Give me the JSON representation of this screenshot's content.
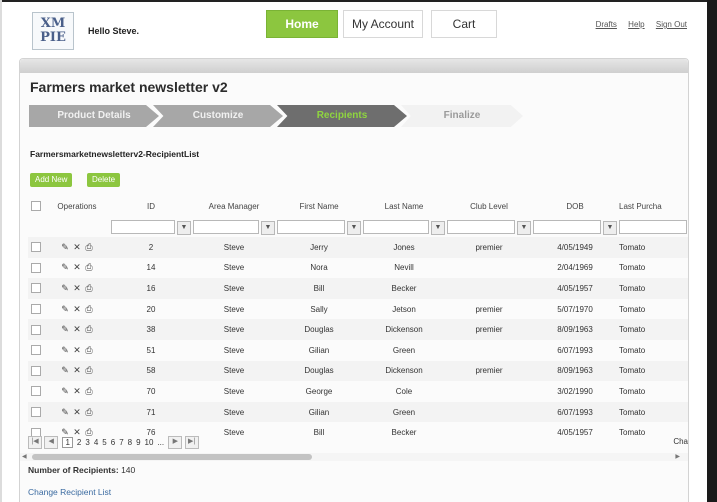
{
  "header": {
    "logo_line1": "XM",
    "logo_line2": "PIE",
    "greeting": "Hello Steve.",
    "nav": {
      "home": "Home",
      "account": "My Account",
      "cart": "Cart"
    },
    "links": {
      "drafts": "Drafts",
      "help": "Help",
      "signout": "Sign Out"
    }
  },
  "page": {
    "title": "Farmers market newsletter v2",
    "steps": [
      "Product Details",
      "Customize",
      "Recipients",
      "Finalize"
    ],
    "active_step": "Recipients",
    "list_title": "Farmersmarketnewsletterv2-RecipientList",
    "buttons": {
      "add": "Add New",
      "delete": "Delete"
    }
  },
  "table": {
    "columns": [
      "Operations",
      "ID",
      "Area Manager",
      "First Name",
      "Last Name",
      "Club Level",
      "DOB",
      "Last Purcha"
    ],
    "rows": [
      [
        "2",
        "Steve",
        "Jerry",
        "Jones",
        "premier",
        "4/05/1949",
        "Tomato"
      ],
      [
        "14",
        "Steve",
        "Nora",
        "Nevill",
        "",
        "2/04/1969",
        "Tomato"
      ],
      [
        "16",
        "Steve",
        "Bill",
        "Becker",
        "",
        "4/05/1957",
        "Tomato"
      ],
      [
        "20",
        "Steve",
        "Sally",
        "Jetson",
        "premier",
        "5/07/1970",
        "Tomato"
      ],
      [
        "38",
        "Steve",
        "Douglas",
        "Dickenson",
        "premier",
        "8/09/1963",
        "Tomato"
      ],
      [
        "51",
        "Steve",
        "Gilian",
        "Green",
        "",
        "6/07/1993",
        "Tomato"
      ],
      [
        "58",
        "Steve",
        "Douglas",
        "Dickenson",
        "premier",
        "8/09/1963",
        "Tomato"
      ],
      [
        "70",
        "Steve",
        "George",
        "Cole",
        "",
        "3/02/1990",
        "Tomato"
      ],
      [
        "71",
        "Steve",
        "Gilian",
        "Green",
        "",
        "6/07/1993",
        "Tomato"
      ],
      [
        "76",
        "Steve",
        "Bill",
        "Becker",
        "",
        "4/05/1957",
        "Tomato"
      ]
    ]
  },
  "pager": {
    "pages": [
      "1",
      "2",
      "3",
      "4",
      "5",
      "6",
      "7",
      "8",
      "9",
      "10",
      "..."
    ],
    "current": "1",
    "right_text": "Cha"
  },
  "footer": {
    "recipients_label": "Number of Recipients:",
    "recipients_count": "140",
    "change_link": "Change Recipient List"
  },
  "colors": {
    "accent": "#8cc63f",
    "active_step": "#6e6e6e",
    "link": "#3a6aa0"
  }
}
